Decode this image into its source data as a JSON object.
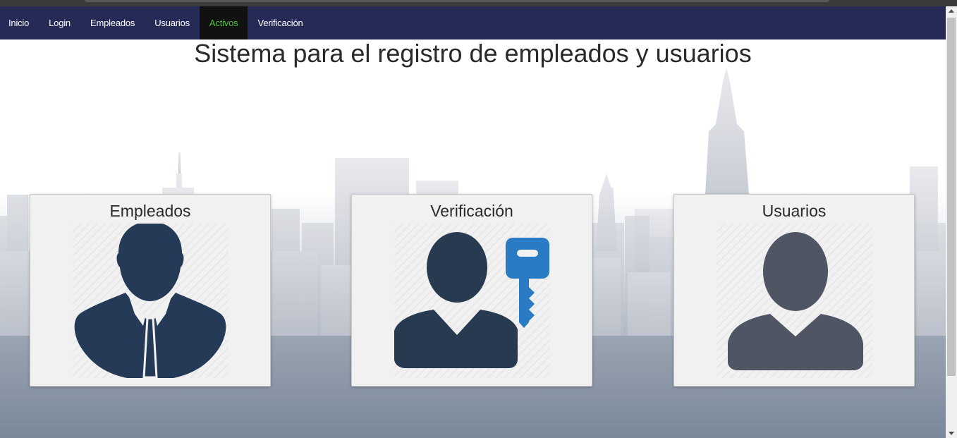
{
  "nav": {
    "items": [
      {
        "label": "Inicio",
        "active": false
      },
      {
        "label": "Login",
        "active": false
      },
      {
        "label": "Empleados",
        "active": false
      },
      {
        "label": "Usuarios",
        "active": false
      },
      {
        "label": "Activos",
        "active": true
      },
      {
        "label": "Verificación",
        "active": false
      }
    ]
  },
  "page": {
    "title": "Sistema para el registro de empleados y usuarios"
  },
  "cards": [
    {
      "title": "Empleados",
      "icon": "employee-suit-icon"
    },
    {
      "title": "Verificación",
      "icon": "user-key-icon"
    },
    {
      "title": "Usuarios",
      "icon": "user-icon"
    }
  ],
  "colors": {
    "navbar": "#262a57",
    "nav_active_bg": "#111111",
    "nav_active_text": "#4bbf3b",
    "icon_dark": "#243a56",
    "key_blue": "#2b7bc4",
    "user_gray": "#4f5563"
  }
}
